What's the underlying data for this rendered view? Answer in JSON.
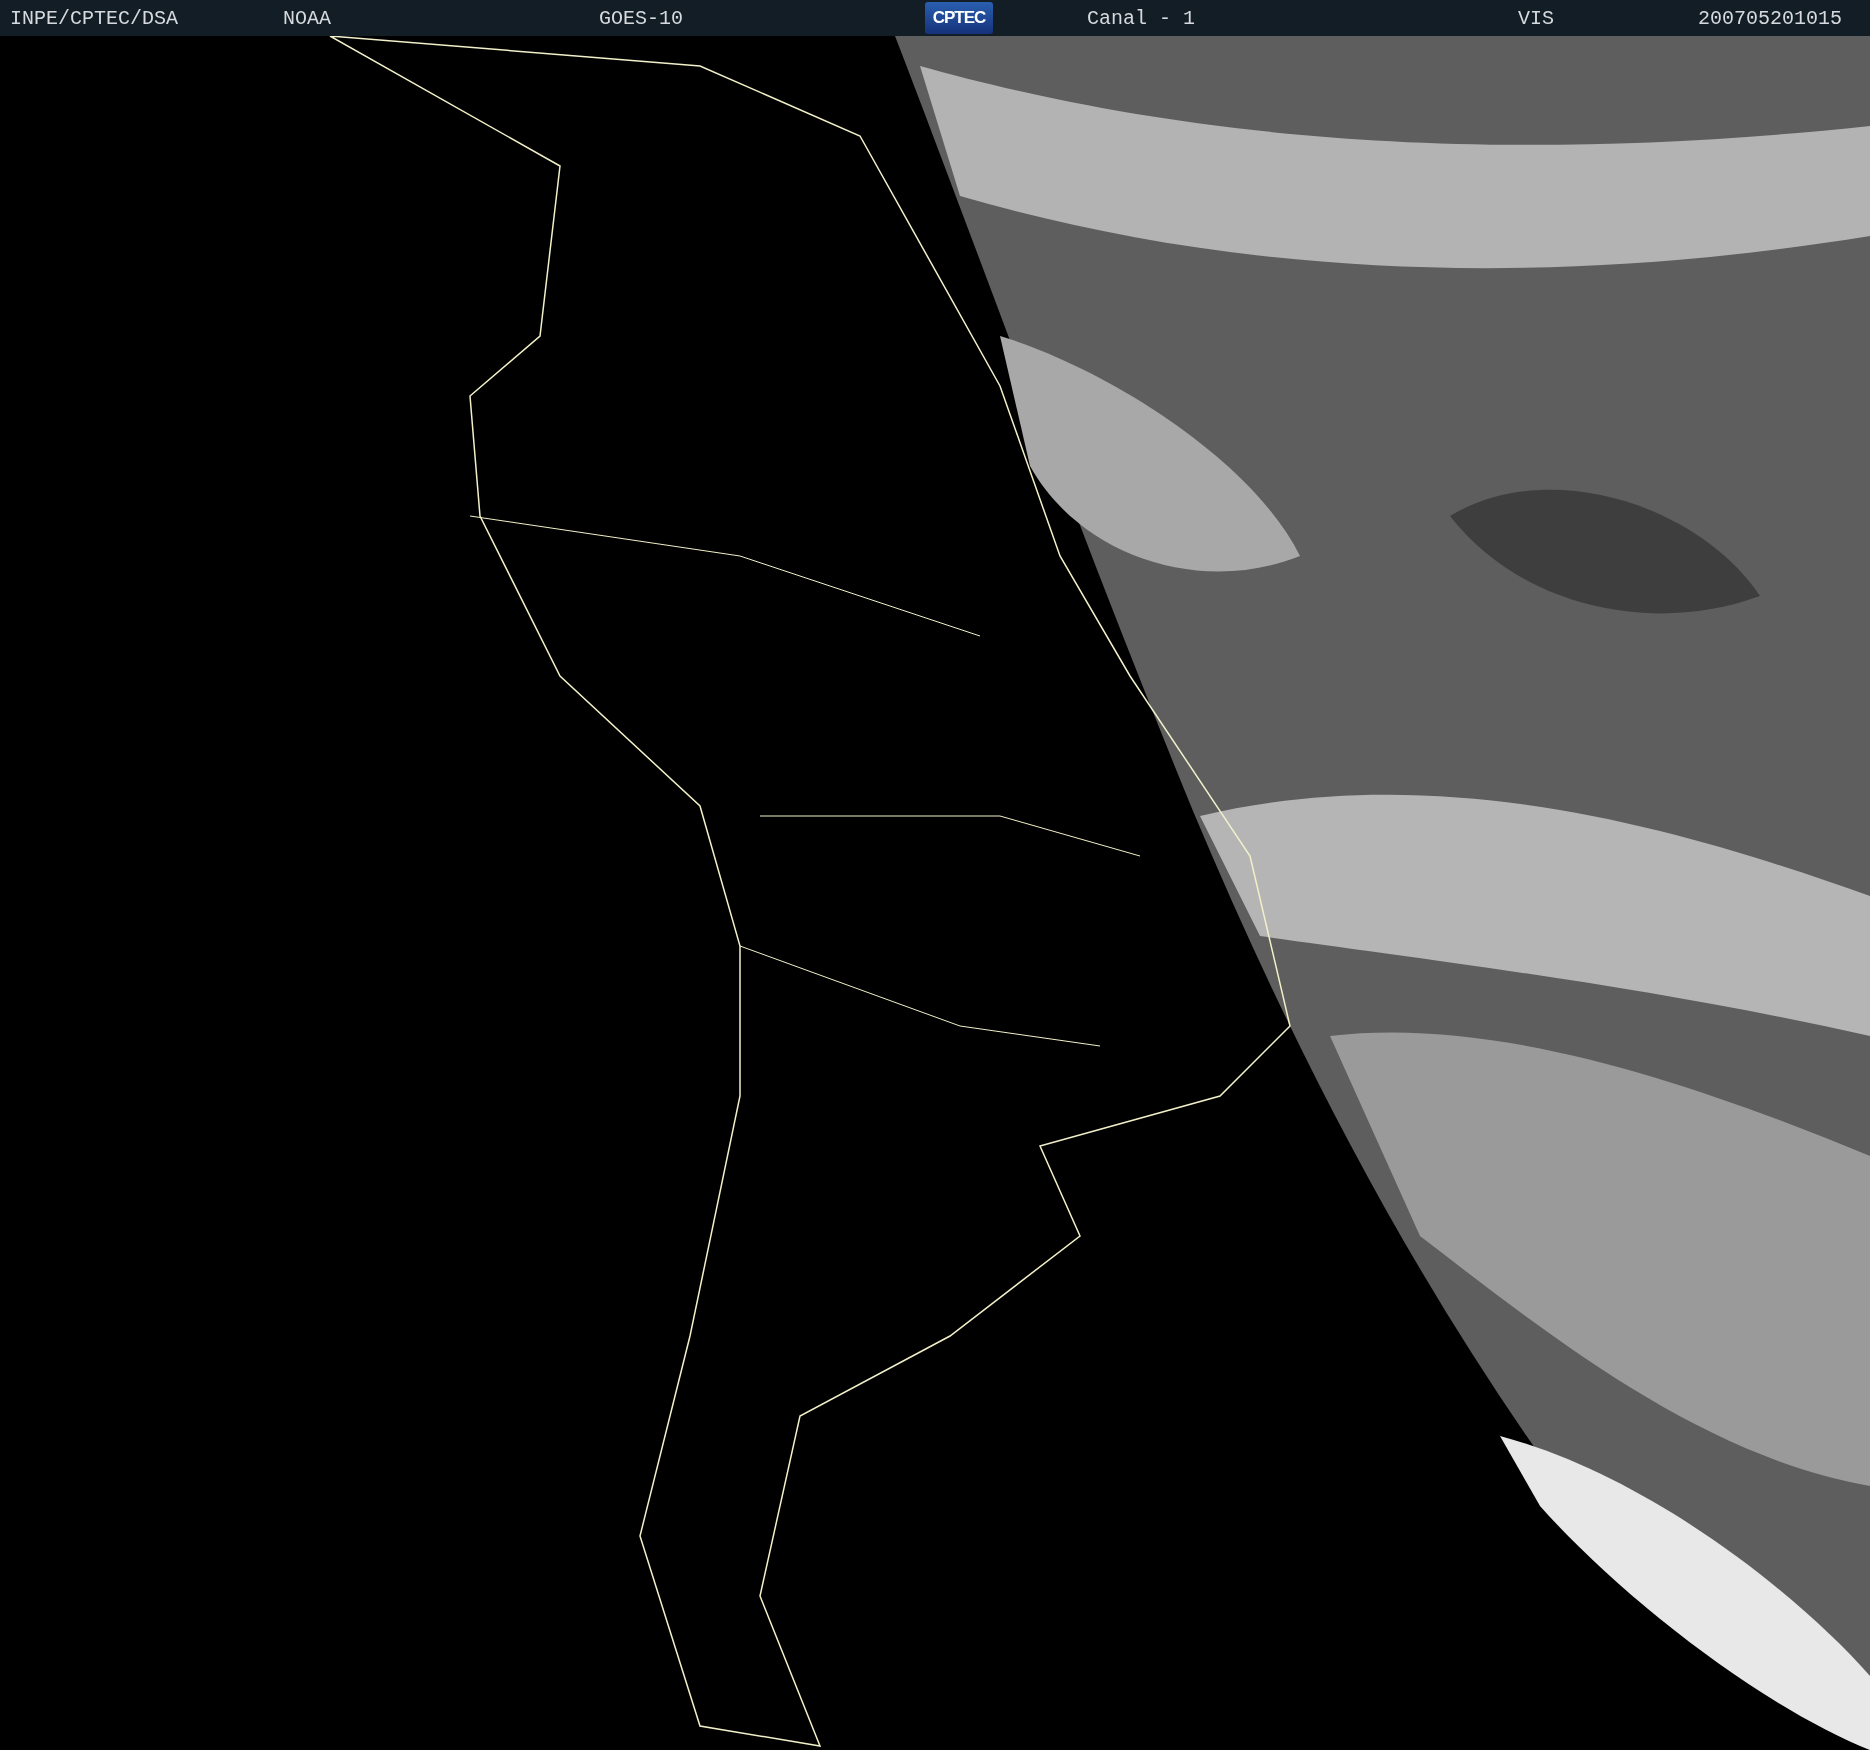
{
  "header": {
    "items": [
      {
        "kind": "text",
        "text": "INPE/CPTEC/DSA"
      },
      {
        "kind": "text",
        "text": "NOAA"
      },
      {
        "kind": "text",
        "text": "GOES-10"
      },
      {
        "kind": "logo",
        "text": "CPTEC"
      },
      {
        "kind": "text",
        "text": "Canal - 1"
      },
      {
        "kind": "text",
        "text": "VIS"
      },
      {
        "kind": "text",
        "text": "200705201015"
      }
    ]
  }
}
